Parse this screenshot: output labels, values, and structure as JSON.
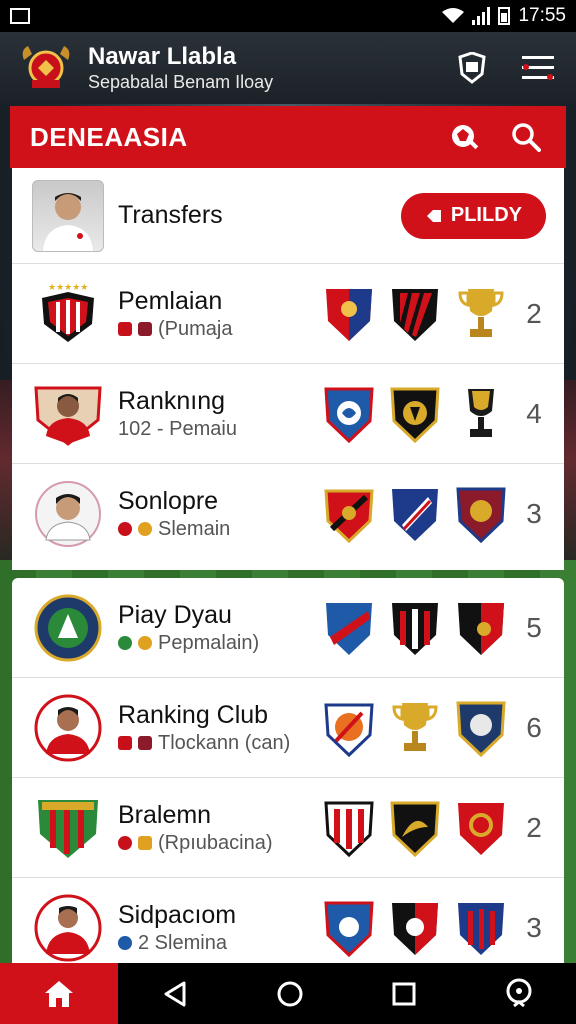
{
  "status_bar": {
    "time": "17:55"
  },
  "header": {
    "app_title": "Nawar Llabla",
    "subtitle": "Sepabalal Benam Iloay"
  },
  "section": {
    "title": "DENEAASIA"
  },
  "transfers": {
    "label": "Transfers",
    "button_label": "PLILDY"
  },
  "rows": [
    {
      "title": "Pemlaian",
      "sub": "(Pumaja",
      "count": "2"
    },
    {
      "title": "Ranknıng",
      "sub": "102 - Pemaiu",
      "count": "4"
    },
    {
      "title": "Sonlopre",
      "sub": "Slemain",
      "count": "3"
    },
    {
      "title": "Piay Dyau",
      "sub": "Pepmalain)",
      "count": "5"
    },
    {
      "title": "Ranking Club",
      "sub": "Tlockann (can)",
      "count": "6"
    },
    {
      "title": "Bralemn",
      "sub": "(Rpıubacina)",
      "count": "2"
    },
    {
      "title": "Sidpacıom",
      "sub": "2  Slemina",
      "count": "3"
    }
  ],
  "colors": {
    "accent": "#d0111a",
    "header_bg": "#1f262c"
  },
  "icons": [
    "home-icon",
    "back-icon",
    "circle-home-icon",
    "square-recents-icon",
    "assistant-icon",
    "search-icon",
    "ball-icon",
    "shield-icon",
    "menu-icon"
  ]
}
